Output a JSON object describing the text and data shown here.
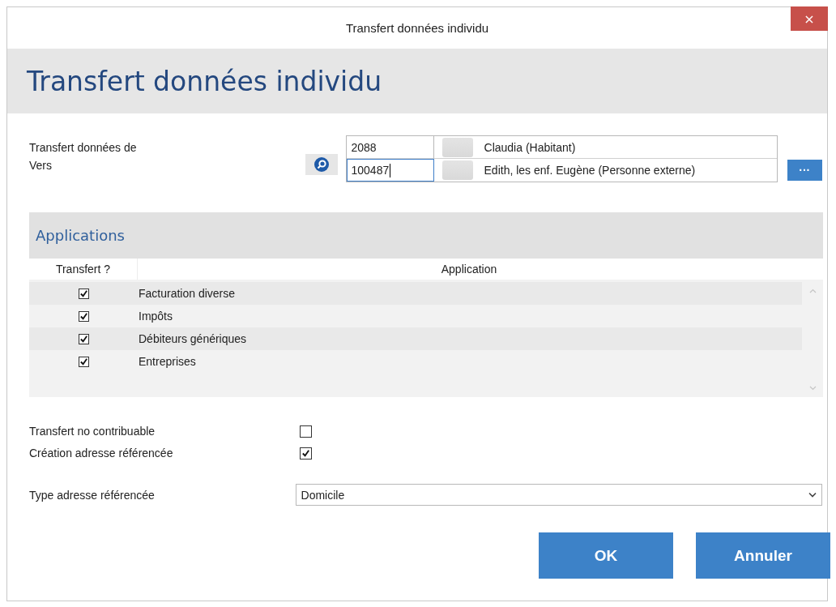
{
  "window": {
    "title": "Transfert données individu",
    "close": "×"
  },
  "header": {
    "title": "Transfert données individu"
  },
  "transfer": {
    "from": {
      "label": "Transfert données de",
      "number": "2088",
      "name": "Claudia (Habitant)"
    },
    "to": {
      "label": "Vers",
      "number": "100487",
      "name": "Edith, les enf. Eugène (Personne externe)"
    },
    "more_button": "···"
  },
  "applications": {
    "title": "Applications",
    "columns": [
      "Transfert ?",
      "Application"
    ],
    "rows": [
      {
        "name": "Facturation diverse",
        "checked": true
      },
      {
        "name": "Impôts",
        "checked": true
      },
      {
        "name": "Débiteurs génériques",
        "checked": true
      },
      {
        "name": "Entreprises",
        "checked": true
      }
    ]
  },
  "options": [
    {
      "label": "Transfert no contribuable",
      "checked": false
    },
    {
      "label": "Création adresse référencée",
      "checked": true
    }
  ],
  "address_type": {
    "label": "Type adresse référencée",
    "value": "Domicile"
  },
  "buttons": [
    "OK",
    "Annuler"
  ]
}
